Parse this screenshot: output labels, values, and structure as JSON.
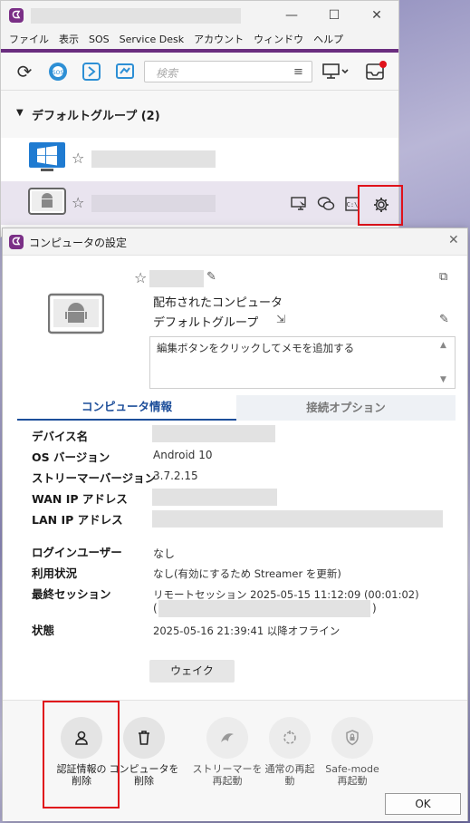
{
  "main_window": {
    "menu": [
      "ファイル",
      "表示",
      "SOS",
      "Service Desk",
      "アカウント",
      "ウィンドウ",
      "ヘルプ"
    ],
    "search_placeholder": "検索",
    "group_name": "デフォルトグループ (2)",
    "window_controls": {
      "minimize": "—",
      "maximize": "☐",
      "close": "✕"
    },
    "toolbar_icons": [
      "refresh-icon",
      "sos-icon",
      "service-desk-icon",
      "presentation-icon",
      "filter-icon",
      "display-icon",
      "inbox-icon"
    ]
  },
  "dialog": {
    "title": "コンピュータの設定",
    "computer_type": "配布されたコンピュータ",
    "group": "デフォルトグループ",
    "memo_placeholder": "編集ボタンをクリックしてメモを追加する",
    "tabs": [
      "コンピュータ情報",
      "接続オプション"
    ],
    "info": {
      "device_name_label": "デバイス名",
      "os_label": "OS バージョン",
      "os_value": "Android 10",
      "streamer_label": "ストリーマーバージョン",
      "streamer_value": "3.7.2.15",
      "wan_label": "WAN IP アドレス",
      "lan_label": "LAN IP アドレス",
      "login_label": "ログインユーザー",
      "login_value": "なし",
      "usage_label": "利用状況",
      "usage_value": "なし(有効にするため Streamer を更新)",
      "last_label": "最終セッション",
      "last_value": "リモートセッション 2025-05-15 11:12:09 (00:01:02)",
      "last_paren_open": "(",
      "last_paren_close": ")",
      "status_label": "状態",
      "status_value": "2025-05-16 21:39:41 以降オフライン"
    },
    "wake_button": "ウェイク",
    "footer_buttons": [
      {
        "label1": "認証情報の",
        "label2": "削除"
      },
      {
        "label1": "コンピュータを",
        "label2": "削除"
      },
      {
        "label1": "ストリーマーを",
        "label2": "再起動"
      },
      {
        "label1": "通常の再起",
        "label2": "動"
      },
      {
        "label1": "Safe-mode",
        "label2": "再起動"
      }
    ],
    "ok_button": "OK"
  },
  "colors": {
    "brand": "#6a2d7f",
    "tab_active": "#1d4e9a",
    "highlight": "#e0121b"
  }
}
